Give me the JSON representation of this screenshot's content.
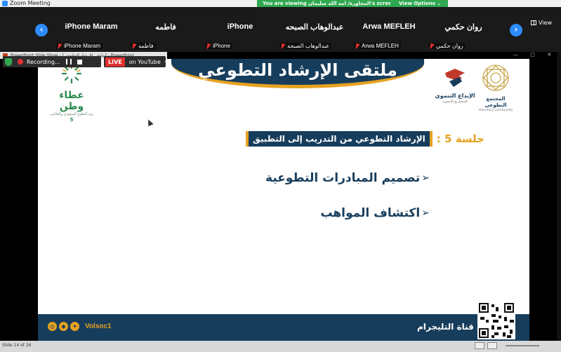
{
  "app": {
    "title": "Zoom Meeting"
  },
  "viewing": {
    "text": "You are viewing المحاورة/ امة الله سليمان's screen",
    "options_label": "View Options"
  },
  "gallery": {
    "prev": "‹",
    "next": "›",
    "view_label": "View",
    "participants": [
      {
        "name": "iPhone Maram",
        "label": "iPhone Maram"
      },
      {
        "name": "فاطمه",
        "label": "فاطمه"
      },
      {
        "name": "iPhone",
        "label": "iPhone"
      },
      {
        "name": "عبدالوهاب الصبحه",
        "label": "عبدالوهاب الصبحه"
      },
      {
        "name": "Arwa MEFLEH",
        "label": "Arwa MEFLEH"
      },
      {
        "name": "روان حكمي",
        "label": "روان حكمي"
      }
    ]
  },
  "ppt": {
    "title": "PowerPoint Slide Show - [ملتقى الإرشاد التطوعي] - PowerPoint"
  },
  "recording": {
    "text": "Recording...",
    "live_badge": "LIVE",
    "live_target": "on YouTube"
  },
  "slide": {
    "title": "ملتقى الإرشاد التطوعي",
    "logo_left": {
      "brand": "عطاء وطن",
      "sub": "يوم التطوع السعودي والعالمي",
      "num": "5"
    },
    "logo_r1": {
      "line1": "الإبداع التنموي",
      "line2": "للمشاريع التنموية"
    },
    "logo_r2": {
      "line1": "المجتمع التطوعي",
      "line2": "Voluntary Community"
    },
    "session_num": "جلسة 5 :",
    "session_title": "الإرشاد التطوعي من التدريب إلى التطبيق",
    "bullets": [
      "تصميم المبادرات التطوعية",
      "اكتشاف المواهب"
    ],
    "footer": {
      "handle": "Volsoc1",
      "telegram": "قناة التليجرام"
    }
  },
  "status": {
    "slide_info": "Slide 14 of 26"
  },
  "colors": {
    "navy": "#173d5c",
    "gold": "#e6a221",
    "zoom_blue": "#2d8cff",
    "green": "#2fa84f"
  }
}
